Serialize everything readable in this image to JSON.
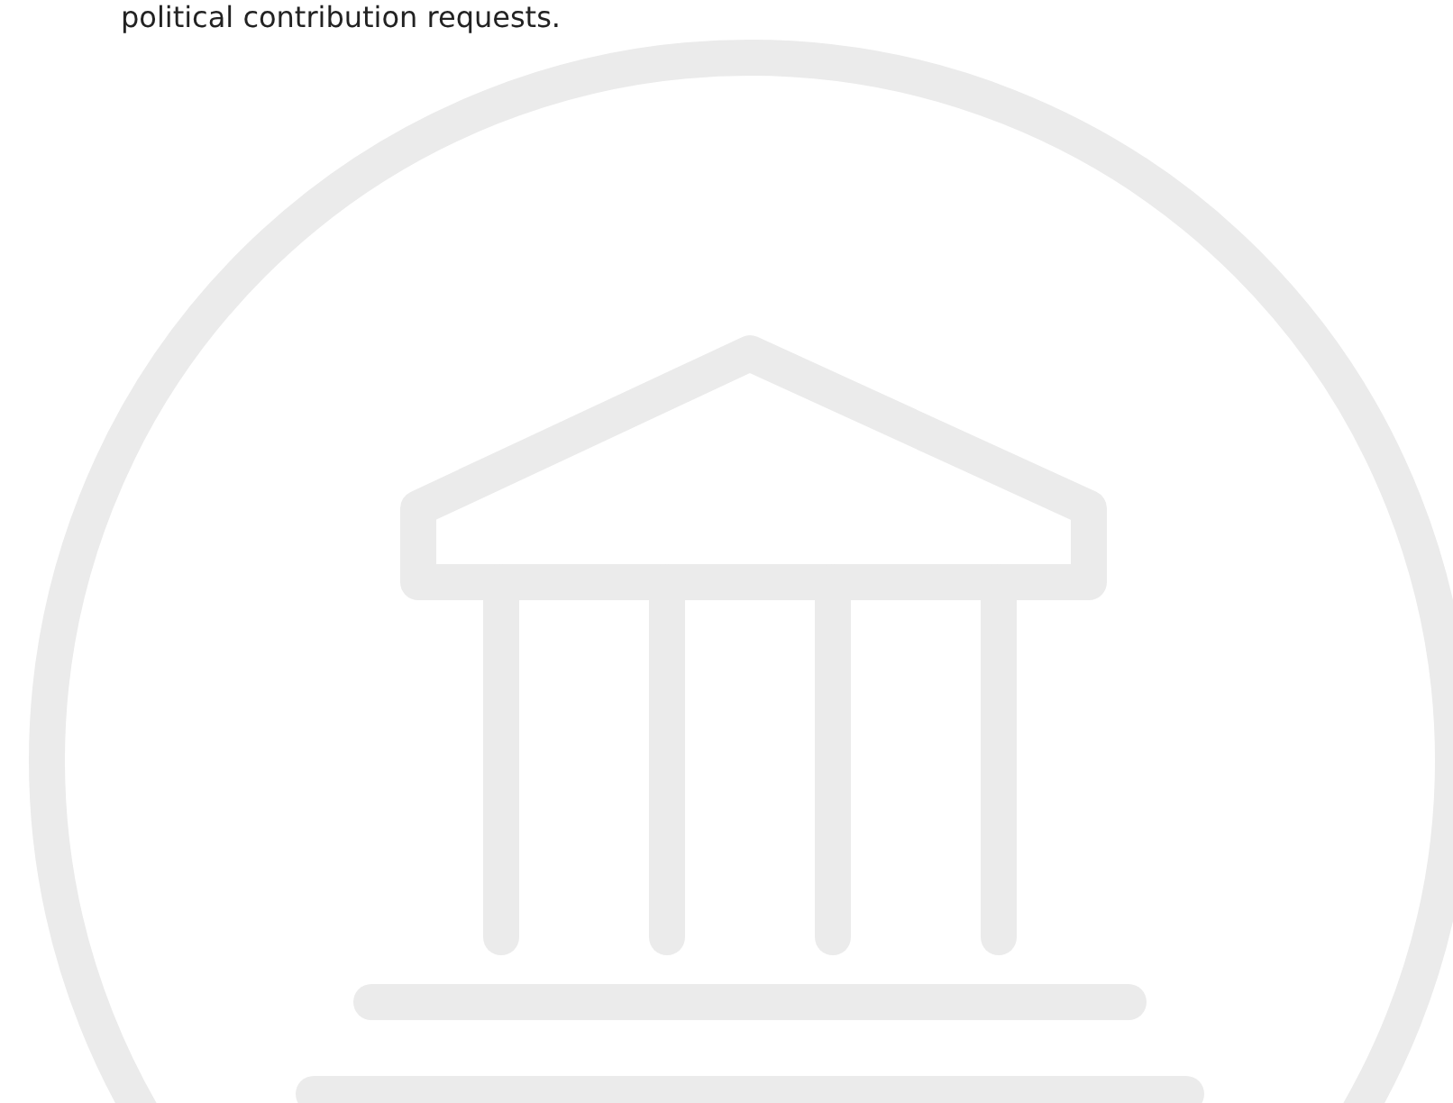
{
  "intro": {
    "text": "political contribution requests."
  }
}
